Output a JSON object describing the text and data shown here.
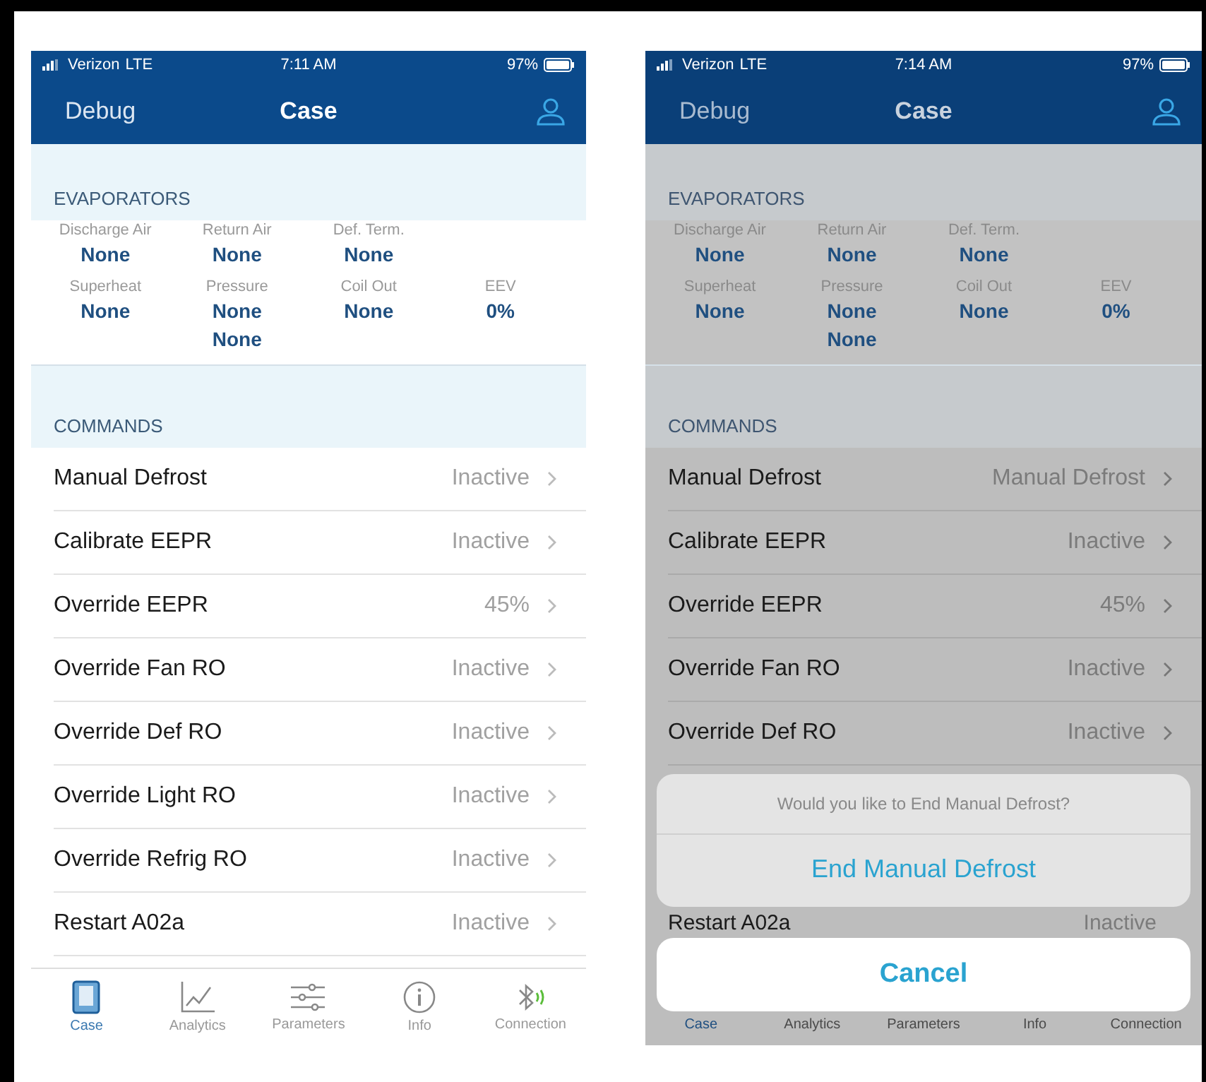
{
  "phones": [
    {
      "dimmed": false,
      "status": {
        "carrier": "Verizon",
        "network": "LTE",
        "time": "7:11 AM",
        "battery": "97%"
      },
      "nav": {
        "left": "Debug",
        "title": "Case"
      },
      "evaporators": {
        "heading": "EVAPORATORS",
        "rows": [
          [
            {
              "label": "Discharge Air",
              "values": [
                "None"
              ]
            },
            {
              "label": "Return Air",
              "values": [
                "None"
              ]
            },
            {
              "label": "Def. Term.",
              "values": [
                "None"
              ]
            }
          ],
          [
            {
              "label": "Superheat",
              "values": [
                "None"
              ]
            },
            {
              "label": "Pressure",
              "values": [
                "None",
                "None"
              ]
            },
            {
              "label": "Coil Out",
              "values": [
                "None"
              ]
            },
            {
              "label": "EEV",
              "values": [
                "0%"
              ]
            }
          ]
        ]
      },
      "commands": {
        "heading": "COMMANDS",
        "items": [
          {
            "label": "Manual Defrost",
            "value": "Inactive"
          },
          {
            "label": "Calibrate EEPR",
            "value": "Inactive"
          },
          {
            "label": "Override EEPR",
            "value": "45%"
          },
          {
            "label": "Override Fan RO",
            "value": "Inactive"
          },
          {
            "label": "Override Def RO",
            "value": "Inactive"
          },
          {
            "label": "Override Light RO",
            "value": "Inactive"
          },
          {
            "label": "Override Refrig RO",
            "value": "Inactive"
          },
          {
            "label": "Restart A02a",
            "value": "Inactive"
          }
        ]
      },
      "tabs": [
        {
          "label": "Case",
          "selected": true,
          "kind": "case"
        },
        {
          "label": "Analytics",
          "selected": false,
          "kind": "chart"
        },
        {
          "label": "Parameters",
          "selected": false,
          "kind": "sliders"
        },
        {
          "label": "Info",
          "selected": false,
          "kind": "info"
        },
        {
          "label": "Connection",
          "selected": false,
          "kind": "bluetooth"
        }
      ]
    },
    {
      "dimmed": true,
      "status": {
        "carrier": "Verizon",
        "network": "LTE",
        "time": "7:14 AM",
        "battery": "97%"
      },
      "nav": {
        "left": "Debug",
        "title": "Case"
      },
      "evaporators": {
        "heading": "EVAPORATORS",
        "rows": [
          [
            {
              "label": "Discharge Air",
              "values": [
                "None"
              ]
            },
            {
              "label": "Return Air",
              "values": [
                "None"
              ]
            },
            {
              "label": "Def. Term.",
              "values": [
                "None"
              ]
            }
          ],
          [
            {
              "label": "Superheat",
              "values": [
                "None"
              ]
            },
            {
              "label": "Pressure",
              "values": [
                "None",
                "None"
              ]
            },
            {
              "label": "Coil Out",
              "values": [
                "None"
              ]
            },
            {
              "label": "EEV",
              "values": [
                "0%"
              ]
            }
          ]
        ]
      },
      "commands": {
        "heading": "COMMANDS",
        "items": [
          {
            "label": "Manual Defrost",
            "value": "Manual Defrost"
          },
          {
            "label": "Calibrate EEPR",
            "value": "Inactive"
          },
          {
            "label": "Override EEPR",
            "value": "45%"
          },
          {
            "label": "Override Fan RO",
            "value": "Inactive"
          },
          {
            "label": "Override Def RO",
            "value": "Inactive"
          }
        ]
      },
      "sheet": {
        "message": "Would you like to End Manual Defrost?",
        "action": "End Manual Defrost",
        "cancel": "Cancel"
      },
      "trailing_item": {
        "label": "Restart A02a",
        "value": "Inactive"
      },
      "tabs": [
        {
          "label": "Case",
          "selected": true
        },
        {
          "label": "Analytics",
          "selected": false
        },
        {
          "label": "Parameters",
          "selected": false
        },
        {
          "label": "Info",
          "selected": false
        },
        {
          "label": "Connection",
          "selected": false
        }
      ]
    }
  ]
}
